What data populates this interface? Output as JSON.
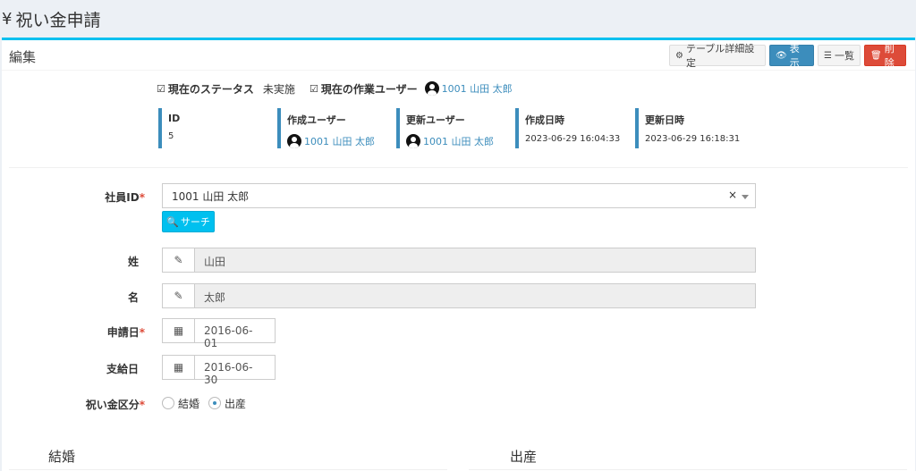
{
  "page": {
    "icon": "yen-icon",
    "title": "祝い金申請"
  },
  "box": {
    "title": "編集"
  },
  "toolbar": {
    "setting_label": "テーブル詳細設定",
    "show_label": "表示",
    "list_label": "一覧",
    "delete_label": "削除"
  },
  "status": {
    "status_label": "現在のステータス",
    "status_value": "未実施",
    "worker_label": "現在の作業ユーザー",
    "worker_value": "1001 山田 太郎"
  },
  "info": {
    "id_label": "ID",
    "id_value": "5",
    "creator_label": "作成ユーザー",
    "creator_value": "1001 山田 太郎",
    "updater_label": "更新ユーザー",
    "updater_value": "1001 山田 太郎",
    "created_label": "作成日時",
    "created_value": "2023-06-29 16:04:33",
    "updated_label": "更新日時",
    "updated_value": "2023-06-29 16:18:31"
  },
  "form": {
    "employee_label": "社員ID",
    "employee_value": "1001 山田 太郎",
    "clear_glyph": "×",
    "search_label": "サーチ",
    "sei_label": "姓",
    "sei_value": "山田",
    "mei_label": "名",
    "mei_value": "太郎",
    "apply_date_label": "申請日",
    "apply_date_value": "2016-06-01",
    "pay_date_label": "支給日",
    "pay_date_value": "2016-06-30",
    "category_label": "祝い金区分",
    "category_options": [
      "結婚",
      "出産"
    ],
    "category_selected": "出産",
    "required_mark": "*"
  },
  "sections": {
    "left_title": "結婚",
    "right_title": "出産"
  },
  "colors": {
    "primary": "#3c8dbc",
    "info": "#00c0ef",
    "danger": "#dd4b39",
    "required": "#dd4b39"
  }
}
